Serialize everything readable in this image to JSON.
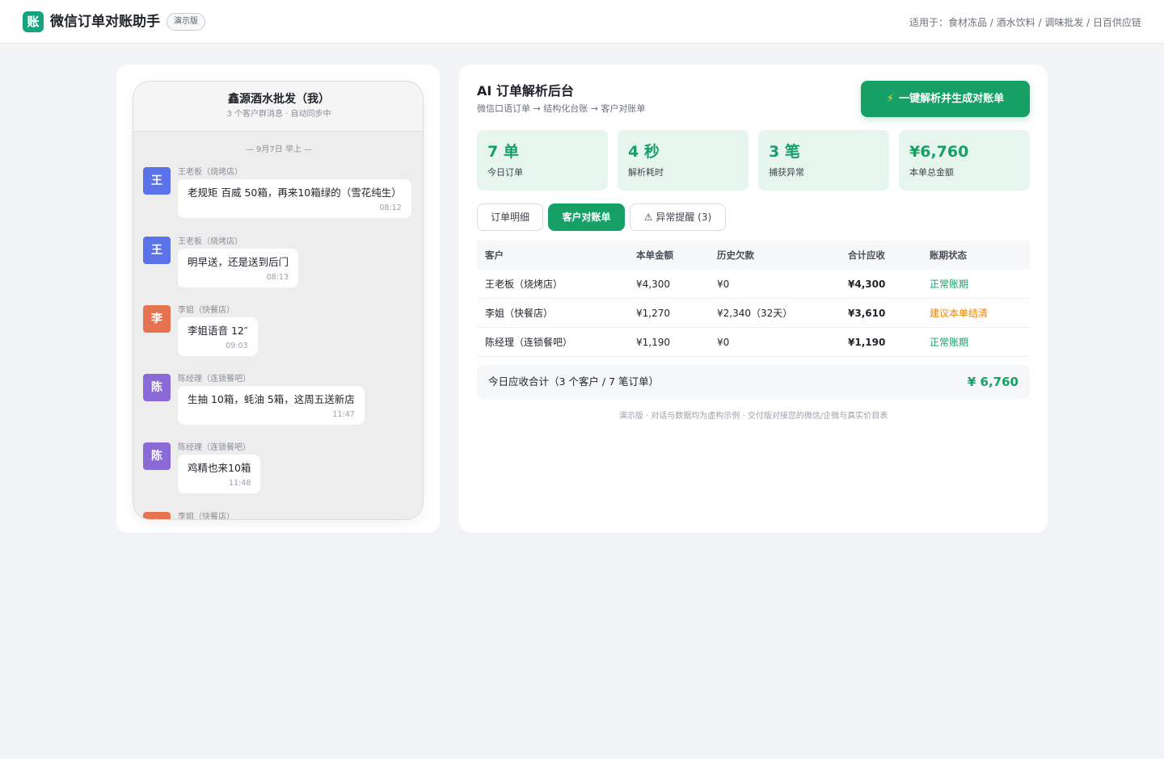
{
  "header": {
    "logo_char": "账",
    "title": "微信订单对账助手",
    "badge": "演示版",
    "applies": "适用于：食材冻品 / 酒水饮料 / 调味批发 / 日百供应链"
  },
  "chat": {
    "title": "鑫源酒水批发（我）",
    "subtitle": "3 个客户群消息 · 自动同步中",
    "date_divider": "— 9月7日 早上 —",
    "messages": [
      {
        "avatar": "王",
        "sender": "王老板（烧烤店）",
        "text": "老规矩 百威 50箱，再来10箱绿的（雪花纯生）",
        "time": "08:12"
      },
      {
        "avatar": "王",
        "sender": "王老板（烧烤店）",
        "text": "明早送，还是送到后门",
        "time": "08:13"
      },
      {
        "avatar": "李",
        "sender": "李姐（快餐店）",
        "text": "李姐语音 12″",
        "time": "09:03"
      },
      {
        "avatar": "陈",
        "sender": "陈经理（连锁餐吧）",
        "text": "生抽 10箱，蚝油 5箱，这周五送新店",
        "time": "11:47"
      },
      {
        "avatar": "陈",
        "sender": "陈经理（连锁餐吧）",
        "text": "鸡精也来10箱",
        "time": "11:48"
      },
      {
        "avatar": "李",
        "sender": "李姐（快餐店）",
        "text": "",
        "time": ""
      }
    ]
  },
  "main": {
    "title": "AI 订单解析后台",
    "subtitle": "微信口语订单 → 结构化台账 → 客户对账单",
    "parse_button": "一键解析并生成对账单",
    "stats": [
      {
        "value": "7 单",
        "label": "今日订单"
      },
      {
        "value": "4 秒",
        "label": "解析耗时"
      },
      {
        "value": "3 笔",
        "label": "捕获异常"
      },
      {
        "value": "¥6,760",
        "label": "本单总金额"
      }
    ],
    "tabs": [
      {
        "label": "订单明细"
      },
      {
        "label": "客户对账单"
      },
      {
        "label": "⚠ 异常提醒 (3)"
      }
    ],
    "table": {
      "headers": [
        "客户",
        "本单金额",
        "历史欠款",
        "合计应收",
        "账期状态"
      ],
      "rows": [
        {
          "customer": "王老板（烧烤店）",
          "amount": "¥4,300",
          "debt": "¥0",
          "total": "¥4,300",
          "status": "正常账期"
        },
        {
          "customer": "李姐（快餐店）",
          "amount": "¥1,270",
          "debt": "¥2,340（32天）",
          "total": "¥3,610",
          "status": "建议本单结清"
        },
        {
          "customer": "陈经理（连锁餐吧）",
          "amount": "¥1,190",
          "debt": "¥0",
          "total": "¥1,190",
          "status": "正常账期"
        }
      ]
    },
    "total_label": "今日应收合计（3 个客户 / 7 笔订单）",
    "total_value": "¥ 6,760",
    "footnote": "演示版 · 对话与数据均为虚构示例 · 交付版对接您的微信/企微与真实价目表"
  },
  "colors": {
    "accent": "#16a066",
    "warning": "#e8860c",
    "avatar_wang": "#5b72e8",
    "avatar_li": "#e5734f",
    "avatar_chen": "#8b6ad8"
  }
}
